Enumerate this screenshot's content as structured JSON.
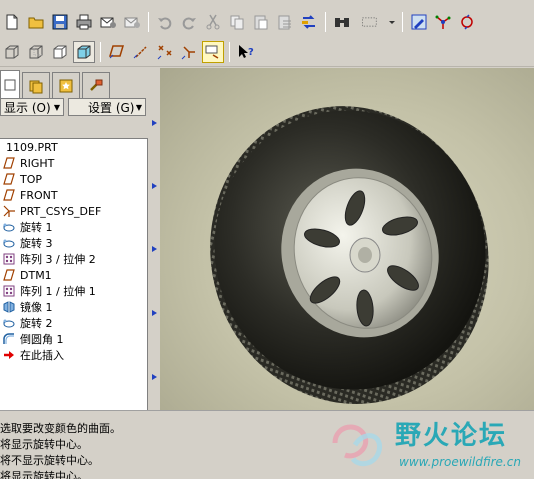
{
  "toolbar_row1": {
    "icons": [
      "new-file-icon",
      "open-folder-icon",
      "save-icon",
      "print-icon",
      "email-icon",
      "email-attach-icon",
      "undo-icon",
      "redo-icon",
      "cut-icon",
      "copy-icon",
      "paste-icon",
      "paste-special-icon",
      "regenerate-icon",
      "find-icon",
      "selection-box-icon",
      "dropdown-arrow-icon",
      "repaint-icon",
      "spin-center-icon",
      "orient-icon"
    ]
  },
  "toolbar_row2": {
    "icons": [
      "wireframe-icon",
      "hidden-line-icon",
      "no-hidden-icon",
      "shading-icon",
      "datum-planes-icon",
      "datum-axes-icon",
      "datum-points-icon",
      "coord-systems-icon",
      "context-help-icon"
    ]
  },
  "left_panel": {
    "tabs": [
      "model-tree-tab",
      "folder-browser-tab",
      "favorites-tab",
      "connections-tab"
    ],
    "show_label": "显示 (O)",
    "settings_label": "设置 (G)",
    "tree_items": [
      {
        "label": "1109.PRT",
        "icon": "part-icon"
      },
      {
        "label": "RIGHT",
        "icon": "datum-plane-icon"
      },
      {
        "label": "TOP",
        "icon": "datum-plane-icon"
      },
      {
        "label": "FRONT",
        "icon": "datum-plane-icon"
      },
      {
        "label": "PRT_CSYS_DEF",
        "icon": "csys-icon"
      },
      {
        "label": "旋转 1",
        "icon": "revolve-icon"
      },
      {
        "label": "旋转 3",
        "icon": "revolve-icon"
      },
      {
        "label": "阵列 3 / 拉伸 2",
        "icon": "pattern-icon"
      },
      {
        "label": "DTM1",
        "icon": "datum-plane-icon"
      },
      {
        "label": "阵列 1 / 拉伸 1",
        "icon": "pattern-icon"
      },
      {
        "label": "镜像 1",
        "icon": "mirror-icon"
      },
      {
        "label": "旋转 2",
        "icon": "revolve-icon"
      },
      {
        "label": "倒圆角 1",
        "icon": "round-icon"
      },
      {
        "label": "在此插入",
        "icon": "insert-here-icon"
      }
    ]
  },
  "messages": [
    "选取要改变颜色的曲面。",
    "将显示旋转中心。",
    "将不显示旋转中心。",
    "将显示旋转中心。"
  ],
  "watermark": {
    "name": "野火论坛",
    "url": "www.proewildfire.cn"
  },
  "colors": {
    "ui_gray": "#d4d0c8",
    "viewport_bg": "#c4c2a8",
    "watermark": "#2aa8b6",
    "accent_blue": "#2040c0"
  }
}
